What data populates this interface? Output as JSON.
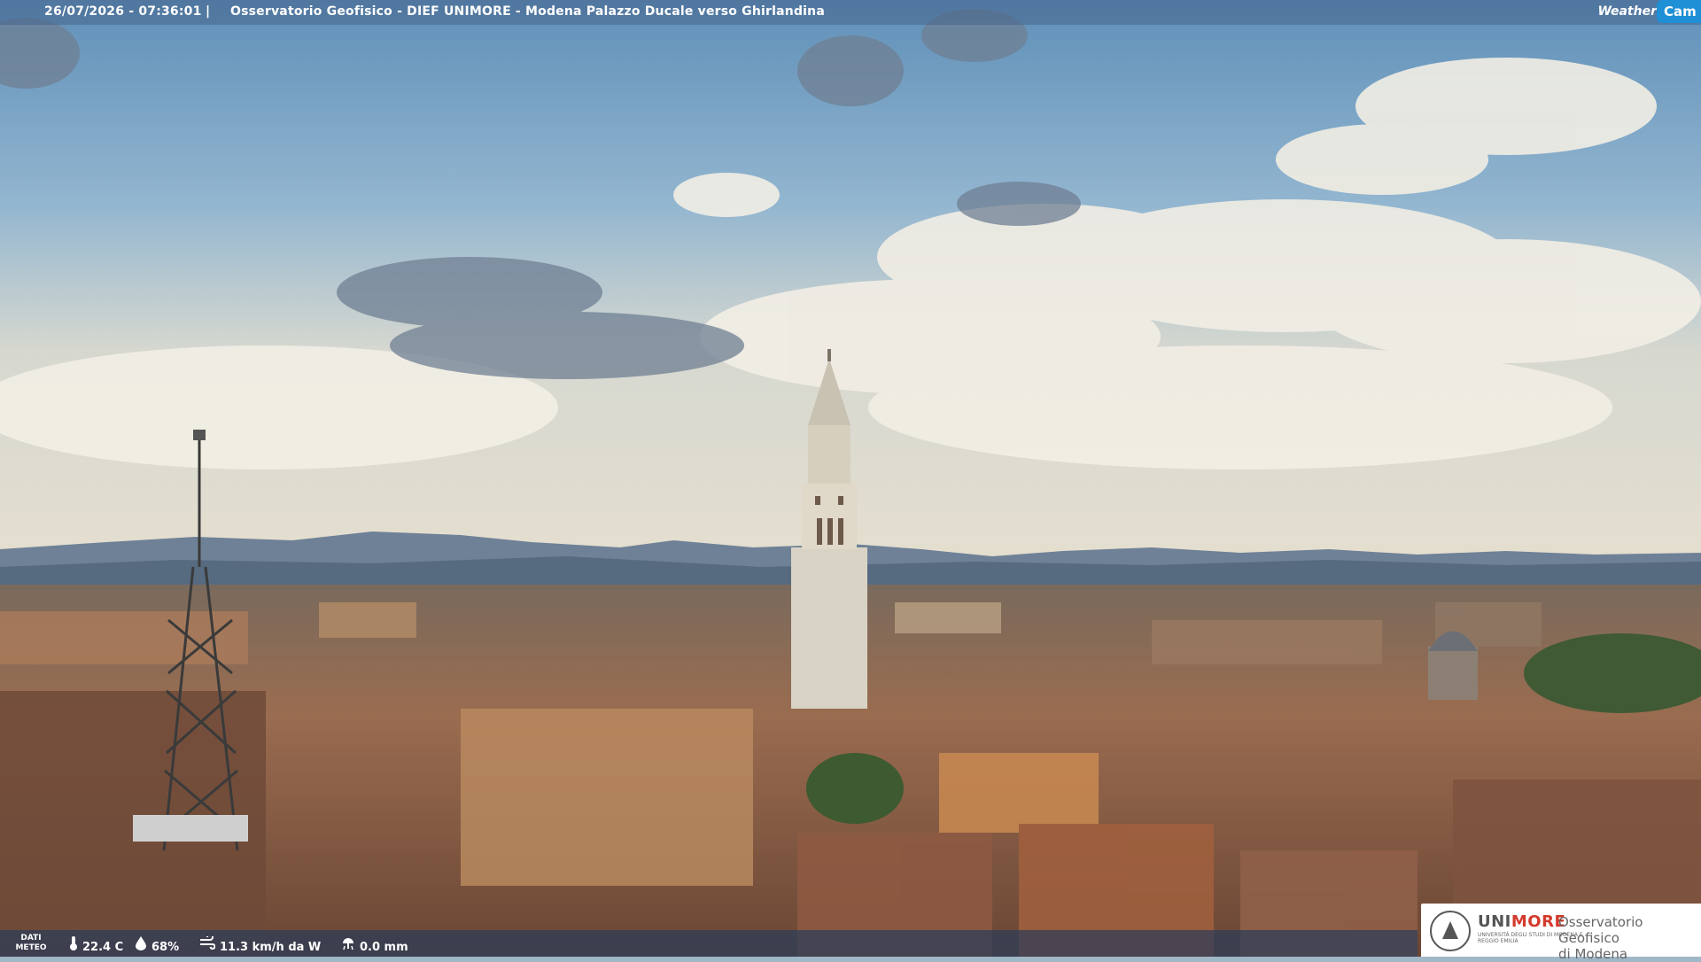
{
  "header": {
    "timestamp": "26/07/2026 - 07:36:01",
    "separator": "|",
    "camera_title": "Osservatorio Geofisico - DIEF UNIMORE - Modena Palazzo Ducale verso Ghirlandina",
    "brand_part1": "Weather",
    "brand_part2": "Cam"
  },
  "weather": {
    "label_line1": "DATI",
    "label_line2": "METEO",
    "temperature": "22.4 C",
    "humidity": "68%",
    "wind": "11.3 km/h da W",
    "rain": "0.0 mm"
  },
  "logo": {
    "university_part1": "UNI",
    "university_part2": "MORE",
    "university_sub": "UNIVERSITÀ DEGLI STUDI DI MODENA E REGGIO EMILIA",
    "observatory_line1": "Osservatorio Geofisico",
    "observatory_line2": "di Modena"
  },
  "icons": {
    "thermometer": "thermometer-icon",
    "humidity": "droplet-icon",
    "wind": "wind-icon",
    "rain": "rain-icon",
    "seal": "university-seal-icon"
  }
}
